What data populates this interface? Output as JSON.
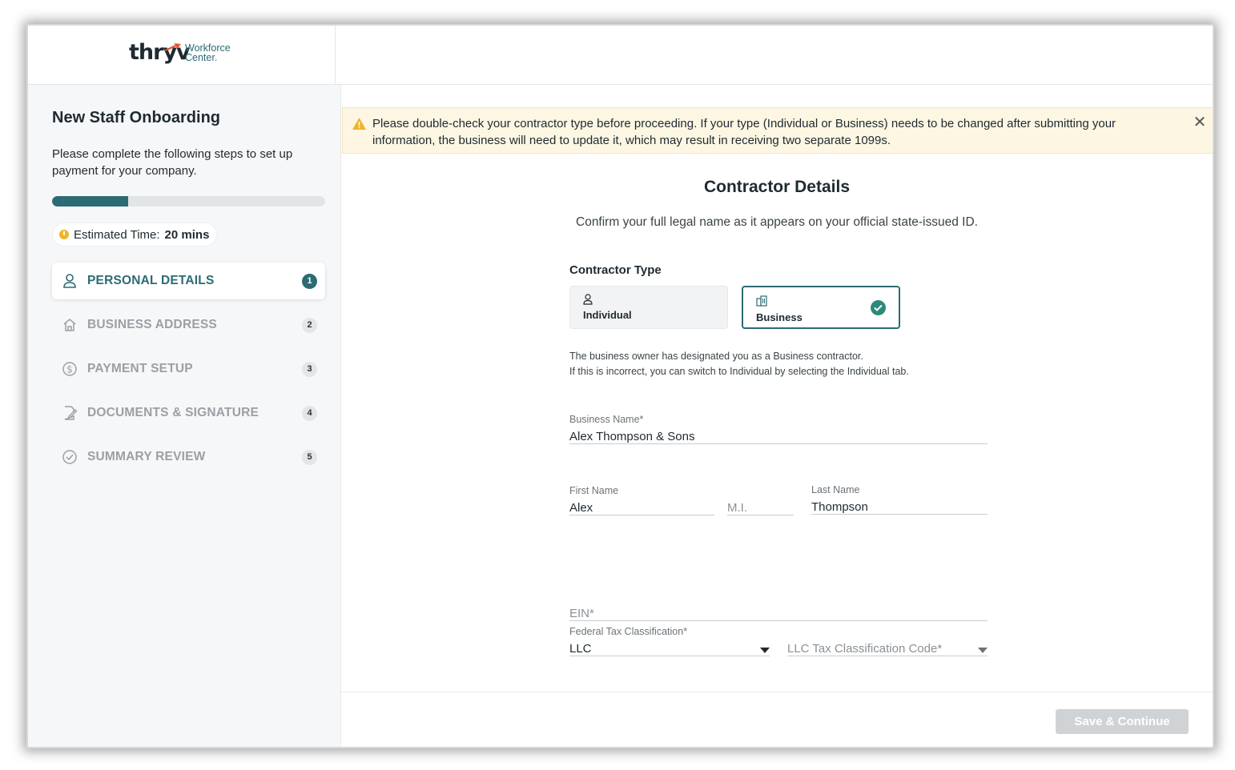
{
  "header": {
    "logo_brand": "thryv",
    "logo_sub_line1": "Workforce",
    "logo_sub_line2": "Center."
  },
  "sidebar": {
    "title": "New Staff Onboarding",
    "description": "Please complete the following steps to set up payment for your company.",
    "progress_percent": 28,
    "estimated_label": "Estimated Time:",
    "estimated_value": "20 mins",
    "steps": [
      {
        "label": "PERSONAL DETAILS",
        "number": "1",
        "icon": "person-icon",
        "active": true
      },
      {
        "label": "BUSINESS ADDRESS",
        "number": "2",
        "icon": "home-icon",
        "active": false
      },
      {
        "label": "PAYMENT SETUP",
        "number": "3",
        "icon": "dollar-icon",
        "active": false
      },
      {
        "label": "DOCUMENTS & SIGNATURE",
        "number": "4",
        "icon": "document-sign-icon",
        "active": false
      },
      {
        "label": "SUMMARY REVIEW",
        "number": "5",
        "icon": "check-circle-icon",
        "active": false
      }
    ]
  },
  "alert": {
    "text": "Please double-check your contractor type before proceeding. If your type (Individual or Business) needs to be changed after submitting your information, the business will need to update it, which may result in receiving two separate 1099s."
  },
  "form": {
    "title": "Contractor Details",
    "subtitle": "Confirm your full legal name as it appears on your official state-issued ID.",
    "contractor_type_label": "Contractor Type",
    "contractor_types": {
      "individual": "Individual",
      "business": "Business",
      "selected": "Business"
    },
    "note_line1": "The business owner has designated you as a Business contractor.",
    "note_line2": "If this is incorrect, you can switch to Individual by selecting the Individual tab.",
    "business_name": {
      "label": "Business Name*",
      "value": "Alex Thompson & Sons"
    },
    "first_name": {
      "label": "First Name",
      "value": "Alex"
    },
    "middle_initial": {
      "placeholder": "M.I."
    },
    "last_name": {
      "label": "Last Name",
      "value": "Thompson"
    },
    "ein": {
      "placeholder": "EIN*"
    },
    "federal_tax": {
      "label": "Federal Tax Classification*",
      "value": "LLC"
    },
    "llc_code": {
      "placeholder": "LLC Tax Classification Code*"
    }
  },
  "footer": {
    "save_label": "Save & Continue"
  },
  "colors": {
    "brand": "#2c6b73",
    "check": "#2c8a7a",
    "warning": "#f0b429",
    "alert_bg": "#fdf6e3"
  }
}
